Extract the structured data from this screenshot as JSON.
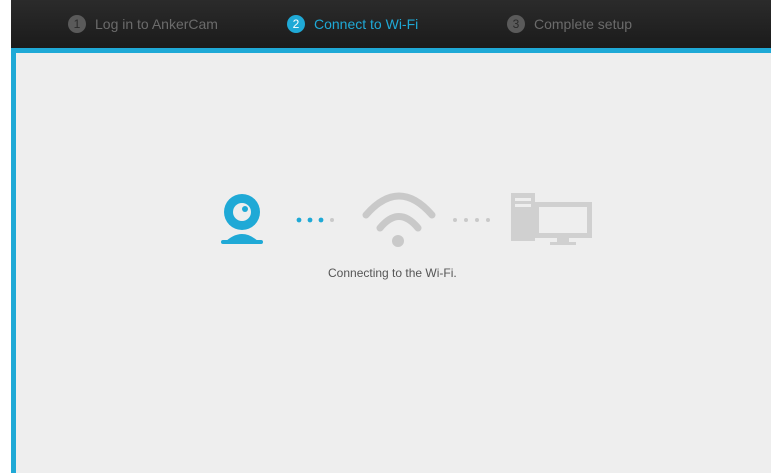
{
  "steps": [
    {
      "number": "1",
      "label": "Log in to AnkerCam",
      "state": "done"
    },
    {
      "number": "2",
      "label": "Connect to Wi-Fi",
      "state": "active"
    },
    {
      "number": "3",
      "label": "Complete setup",
      "state": "pending"
    }
  ],
  "status": {
    "message": "Connecting to the Wi-Fi."
  },
  "illustration": {
    "icons": [
      "camera-icon",
      "wifi-icon",
      "computer-icon"
    ]
  },
  "colors": {
    "accent": "#1fa9d6",
    "stepbar_bg": "#1b1b1b",
    "panel_bg": "#eeeeee",
    "inactive_icon": "#cfcfcf"
  }
}
